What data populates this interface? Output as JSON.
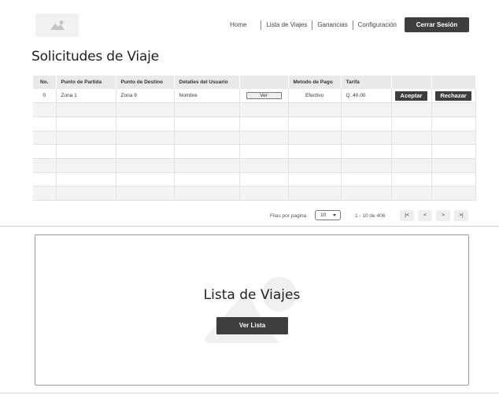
{
  "logo": {
    "icon": "image-placeholder-icon"
  },
  "nav": {
    "items": [
      "Home",
      "Lista de Viajes",
      "Ganancias",
      "Configuración"
    ],
    "logout_label": "Cerrar Sesión"
  },
  "page_title": "Solicitudes de Viaje",
  "table": {
    "headers": [
      "No.",
      "Punto de Partida",
      "Punto de Destino",
      "Detalles del Usuario",
      "",
      "Metodo de Pago",
      "Tarifa",
      "",
      ""
    ],
    "rows": [
      {
        "no": "0",
        "origin": "Zona 1",
        "destination": "Zona 9",
        "user_details": "Nombre",
        "view_label": "Ver",
        "payment": "Efectivo",
        "fare": "Q. 40.00",
        "accept_label": "Aceptar",
        "reject_label": "Rechazar"
      }
    ]
  },
  "pagination": {
    "rows_label": "Filas por pagina",
    "rows_per_page": "10",
    "range_text": "1 - 10 de 406",
    "first_label": "|<",
    "prev_label": "<",
    "next_label": ">",
    "last_label": ">|"
  },
  "trips_card": {
    "title": "Lista de Viajes",
    "button_label": "Ver Lista",
    "icon": "image-placeholder-icon"
  },
  "colors": {
    "dark_button": "#3e3e3e",
    "header_bg": "#e9e9e9"
  }
}
